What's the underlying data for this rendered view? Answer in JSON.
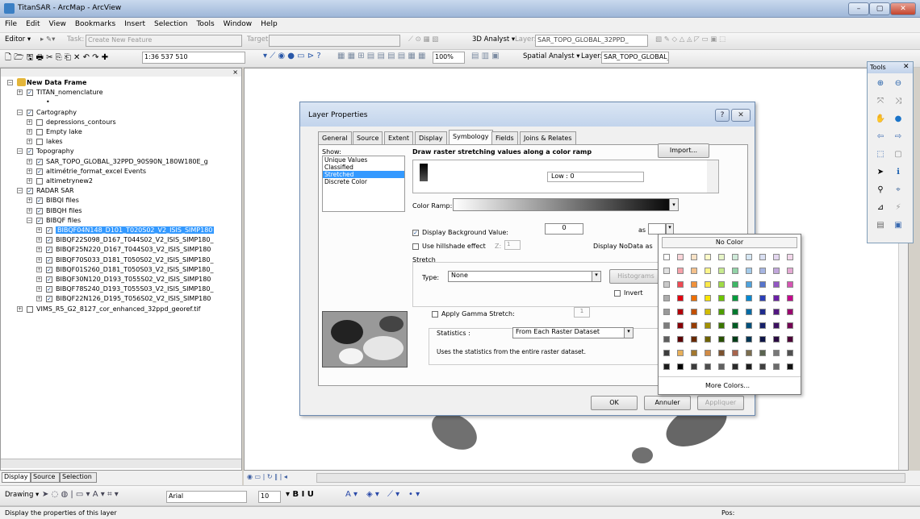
{
  "window": {
    "title": "TitanSAR - ArcMap - ArcView",
    "min_label": "–",
    "max_label": "▢",
    "close_label": "✕"
  },
  "menu": [
    "File",
    "Edit",
    "View",
    "Bookmarks",
    "Insert",
    "Selection",
    "Tools",
    "Window",
    "Help"
  ],
  "editor_toolbar": {
    "editor_label": "Editor ▾",
    "task_label": "Task:",
    "task_value": "Create New Feature",
    "target_label": "Target:",
    "target_value": "",
    "analyst_label": "3D Analyst ▾",
    "layer_label": "Layer:",
    "layer_value": "SAR_TOPO_GLOBAL_32PPD_"
  },
  "standard_toolbar": {
    "scale_value": "1:36 537 510",
    "zoom_value": "100%",
    "spatial_analyst_label": "Spatial Analyst ▾",
    "layer_label": "Layer:",
    "layer_value": "SAR_TOPO_GLOBAL_32P"
  },
  "tools_panel": {
    "title": "Tools"
  },
  "toc": {
    "rows": [
      {
        "label": "New Data Frame",
        "bold": true
      },
      {
        "label": "TITAN_nomenclature"
      },
      {
        "label": "•"
      },
      {
        "label": "Cartography"
      },
      {
        "label": "depressions_contours"
      },
      {
        "label": "Empty lake"
      },
      {
        "label": "lakes"
      },
      {
        "label": "Topography"
      },
      {
        "label": "SAR_TOPO_GLOBAL_32PPD_90S90N_180W180E_g"
      },
      {
        "label": "altimétrie_format_excel Events"
      },
      {
        "label": "altimetrynew2"
      },
      {
        "label": "RADAR SAR"
      },
      {
        "label": "BIBQI files"
      },
      {
        "label": "BIBQH files"
      },
      {
        "label": "BIBQF files"
      },
      {
        "label": "BIBQF04N148_D101_T020S02_V2_ISIS_SIMP180",
        "selected": true
      },
      {
        "label": "BIBQF22S098_D167_T044S02_V2_ISIS_SIMP180_"
      },
      {
        "label": "BIBQF25N220_D167_T044S03_V2_ISIS_SIMP180"
      },
      {
        "label": "BIBQF70S033_D181_T050S02_V2_ISIS_SIMP180_"
      },
      {
        "label": "BIBQF01S260_D181_T050S03_V2_ISIS_SIMP180_"
      },
      {
        "label": "BIBQF30N120_D193_T055S02_V2_ISIS_SIMP180"
      },
      {
        "label": "BIBQF78S240_D193_T055S03_V2_ISIS_SIMP180_"
      },
      {
        "label": "BIBQF22N126_D195_T056S02_V2_ISIS_SIMP180"
      },
      {
        "label": "VIMS_R5_G2_8127_cor_enhanced_32ppd_georef.tif"
      }
    ],
    "tabs": [
      "Display",
      "Source",
      "Selection"
    ]
  },
  "dialog": {
    "title": "Layer Properties",
    "help_label": "?",
    "close_label": "✕",
    "tabs": [
      "General",
      "Source",
      "Extent",
      "Display",
      "Symbology",
      "Fields",
      "Joins & Relates"
    ],
    "active_tab": "Symbology",
    "show_label": "Show:",
    "show_items": [
      "Unique Values",
      "Classified",
      "Stretched",
      "Discrete Color"
    ],
    "show_selected": "Stretched",
    "heading": "Draw raster stretching values along a color ramp",
    "import_label": "Import...",
    "low_label": "Low : 0",
    "color_ramp_label": "Color Ramp:",
    "display_bg_label": "Display Background Value:",
    "display_bg_value": "0",
    "as_label": "as",
    "hillshade_label": "Use hillshade effect",
    "z_label": "Z:",
    "z_value": "1",
    "nodata_label": "Display NoData as",
    "stretch_label": "Stretch",
    "type_label": "Type:",
    "type_value": "None",
    "histograms_label": "Histograms",
    "invert_label": "Invert",
    "gamma_label": "Apply Gamma Stretch:",
    "gamma_value": "1",
    "statistics_label": "Statistics :",
    "statistics_value": "From Each Raster Dataset",
    "statistics_note": "Uses the statistics from the entire raster dataset.",
    "ok_label": "OK",
    "cancel_label": "Annuler",
    "apply_label": "Appliquer"
  },
  "color_popup": {
    "no_color_label": "No Color",
    "more_colors_label": "More Colors...",
    "rows": [
      [
        "#ffffff",
        "#fbd5d9",
        "#f8e2c6",
        "#fefbc8",
        "#e7f5c8",
        "#cfead9",
        "#d6e7f4",
        "#d9dff2",
        "#e3d7ef",
        "#f2d7ea"
      ],
      [
        "#e1e1e1",
        "#f6a1a9",
        "#f4c08b",
        "#fdf58a",
        "#c7ea8f",
        "#92d3a7",
        "#a4cbea",
        "#a6b5e2",
        "#c2a7dc",
        "#e4a9d3"
      ],
      [
        "#c9c9c9",
        "#f04a53",
        "#f0913b",
        "#fbe94a",
        "#a0db45",
        "#3fb766",
        "#4fa3dd",
        "#5674cc",
        "#9357c3",
        "#d654b3"
      ],
      [
        "#acacac",
        "#e4000f",
        "#ee6f00",
        "#f9e400",
        "#6cc400",
        "#009c3c",
        "#0088d2",
        "#2c3fb8",
        "#6b1fa6",
        "#c4088d"
      ],
      [
        "#9a9a9a",
        "#b30009",
        "#c24f00",
        "#d1bc00",
        "#4f9d00",
        "#007a2f",
        "#006ba5",
        "#1f2c8e",
        "#521681",
        "#9a066f"
      ],
      [
        "#7e7e7e",
        "#880007",
        "#963c00",
        "#a29100",
        "#3b7600",
        "#005b23",
        "#00507b",
        "#16206a",
        "#3d1061",
        "#730453"
      ],
      [
        "#5e5e5e",
        "#5c0004",
        "#682900",
        "#6f6300",
        "#285000",
        "#003d17",
        "#003553",
        "#0e1547",
        "#290a41",
        "#4d0338"
      ],
      [
        "#3d3d3d",
        "#e8b05a",
        "#a2772e",
        "#d18b45",
        "#7b522f",
        "#a7644d",
        "#7b6e4e",
        "#5a6450",
        "#787878",
        "#505050"
      ],
      [
        "#1c1c1c",
        "#000000",
        "#3b3b3b",
        "#4d4d4d",
        "#606060",
        "#2a2a2a",
        "#1d1d1d",
        "#404040",
        "#6b6b6b",
        "#111111"
      ]
    ]
  },
  "bottom": {
    "draw_label": "Drawing ▾",
    "font_value": "Arial",
    "size_value": "10"
  },
  "status": {
    "message": "Display the properties of this layer",
    "pos_label": "Pos:"
  }
}
